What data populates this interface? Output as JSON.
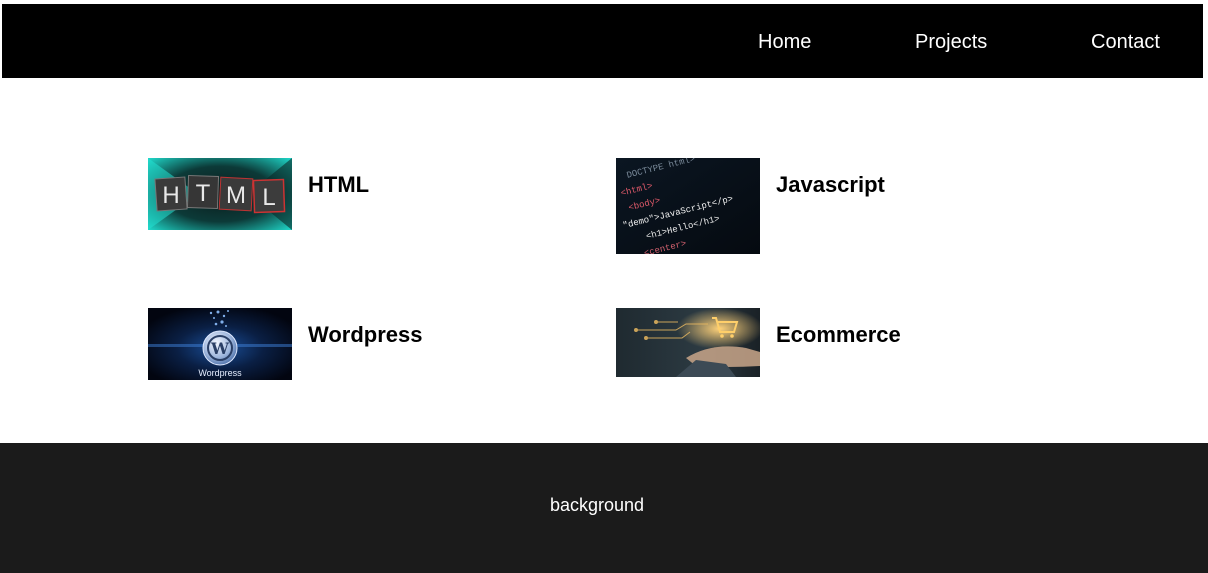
{
  "nav": {
    "items": [
      {
        "label": "Home"
      },
      {
        "label": "Projects"
      },
      {
        "label": "Contact"
      }
    ]
  },
  "projects": [
    {
      "title": "HTML",
      "image": "html-letters-image",
      "image_text": "HTML"
    },
    {
      "title": "Javascript",
      "image": "code-screen-image",
      "image_text": [
        "DOCTYPE html>",
        "<html>",
        "<body>",
        "\"demo\">JavaScript</p>",
        "<h1>Hello</h1>",
        "<center>"
      ]
    },
    {
      "title": "Wordpress",
      "image": "wordpress-logo-image",
      "image_text": "Wordpress"
    },
    {
      "title": "Ecommerce",
      "image": "shopping-cart-hand-image"
    }
  ],
  "footer": {
    "text": "background"
  },
  "colors": {
    "navbar_bg": "#000000",
    "footer_bg": "#1b1b1b",
    "text_on_dark": "#ffffff",
    "page_bg": "#ffffff"
  }
}
